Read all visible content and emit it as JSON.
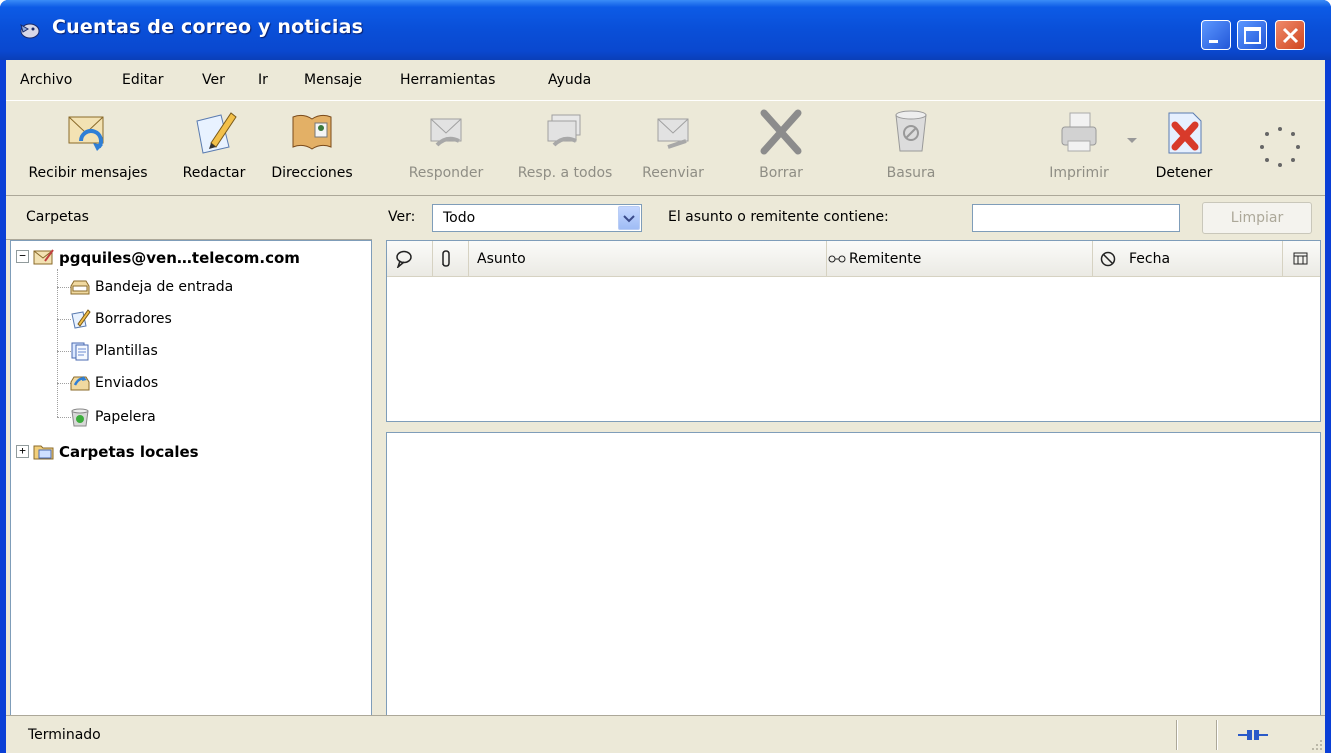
{
  "window": {
    "title": "Cuentas de correo y noticias"
  },
  "menu": [
    "Archivo",
    "Editar",
    "Ver",
    "Ir",
    "Mensaje",
    "Herramientas",
    "Ayuda"
  ],
  "toolbar": {
    "get_messages": "Recibir mensajes",
    "compose": "Redactar",
    "address_book": "Direcciones",
    "reply": "Responder",
    "reply_all": "Resp. a todos",
    "forward": "Reenviar",
    "delete": "Borrar",
    "junk": "Basura",
    "print": "Imprimir",
    "stop": "Detener"
  },
  "folders_header": "Carpetas",
  "filter": {
    "view_label": "Ver:",
    "view_value": "Todo",
    "search_label": "El asunto o remitente contiene:",
    "search_value": "",
    "clear_label": "Limpiar"
  },
  "folder_tree": {
    "account": "pgquiles@ven…telecom.com",
    "folders": [
      "Bandeja de entrada",
      "Borradores",
      "Plantillas",
      "Enviados",
      "Papelera"
    ],
    "local": "Carpetas locales"
  },
  "columns": {
    "subject": "Asunto",
    "sender": "Remitente",
    "date": "Fecha"
  },
  "status": {
    "text": "Terminado"
  }
}
